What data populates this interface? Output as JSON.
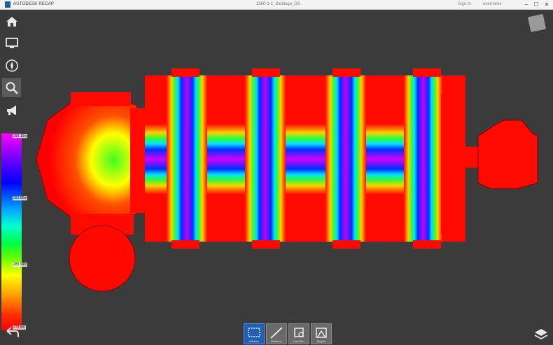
{
  "titlebar": {
    "brand": "AUTODESK RECAP",
    "document": "1560-1-1_Santiago_D3",
    "signin": "Sign In",
    "user": "username",
    "minimize": "–",
    "maximize": "☐",
    "close": "✕"
  },
  "colorbar": {
    "top_label": "288.15m",
    "mid_label": "283.85m",
    "low_label": "280.94m",
    "bottom_label": "278.8m"
  },
  "toolbar": {
    "items": [
      {
        "label": "Window"
      },
      {
        "label": "Distance"
      },
      {
        "label": "Limit Box"
      },
      {
        "label": "Region"
      }
    ]
  },
  "icons": {
    "home": "home-icon",
    "display": "monitor-icon",
    "navigate": "compass-icon",
    "search": "search-icon",
    "announce": "megaphone-icon",
    "back": "back-arrow-icon",
    "layers": "layers-icon",
    "viewcube": "viewcube-icon"
  },
  "colors": {
    "accent": "#1f5fb5",
    "background": "#3d3d3d"
  }
}
